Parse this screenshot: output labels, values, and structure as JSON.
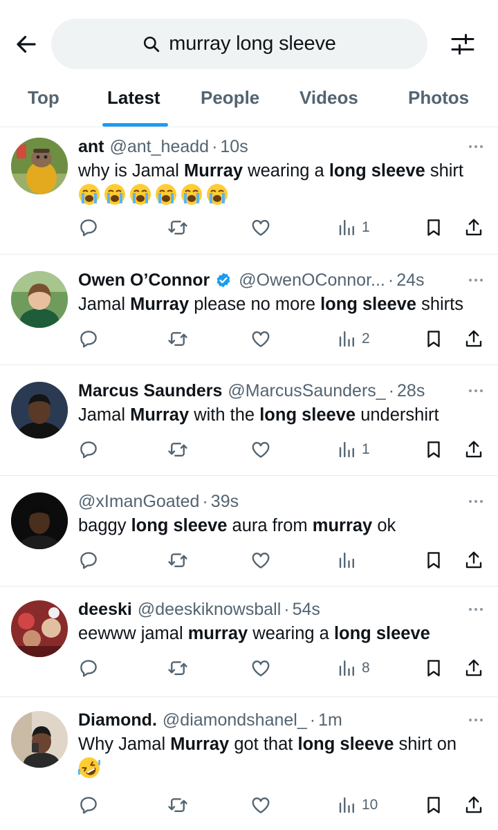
{
  "search": {
    "query": "murray long sleeve"
  },
  "tabs": [
    {
      "label": "Top"
    },
    {
      "label": "Latest"
    },
    {
      "label": "People"
    },
    {
      "label": "Videos"
    },
    {
      "label": "Photos"
    }
  ],
  "active_tab": "Latest",
  "colors": {
    "accent": "#1d9bf0",
    "secondary_text": "#536471",
    "verified": "#1d9bf0",
    "search_bg": "#eff3f4"
  },
  "posts": [
    {
      "name": "ant",
      "handle": "@ant_headd",
      "time": "10s",
      "verified": false,
      "text_plain_1": "why is Jamal ",
      "text_bold_1": "Murray",
      "text_plain_2": " wearing a ",
      "text_bold_2": "long sleeve",
      "text_plain_3": " shirt",
      "emoji": [
        "😭",
        "😭",
        "😭",
        "😭",
        "😭",
        "😭"
      ],
      "views": "1"
    },
    {
      "name": "Owen O’Connor",
      "handle": "@OwenOConnor...",
      "time": "24s",
      "verified": true,
      "text_plain_1": "Jamal ",
      "text_bold_1": "Murray",
      "text_plain_2": " please no more ",
      "text_bold_2": "long sleeve",
      "text_plain_3": " shirts",
      "views": "2"
    },
    {
      "name": "Marcus Saunders",
      "handle": "@MarcusSaunders_",
      "time": "28s",
      "verified": false,
      "text_plain_1": "Jamal ",
      "text_bold_1": "Murray",
      "text_plain_2": " with the ",
      "text_bold_2": "long sleeve",
      "text_plain_3": " undershirt",
      "views": "1"
    },
    {
      "name": "",
      "handle": "@xImanGoated",
      "time": "39s",
      "verified": false,
      "text_plain_1": "baggy ",
      "text_bold_1": "long sleeve",
      "text_plain_2": " aura from ",
      "text_bold_2": "murray",
      "text_plain_3": " ok",
      "views": ""
    },
    {
      "name": "deeski",
      "handle": "@deeskiknowsball",
      "time": "54s",
      "verified": false,
      "text_plain_1": "eewww jamal ",
      "text_bold_1": "murray",
      "text_plain_2": " wearing a ",
      "text_bold_2": "long sleeve",
      "text_plain_3": "",
      "views": "8"
    },
    {
      "name": "Diamond.",
      "handle": "@diamondshanel_",
      "time": "1m",
      "verified": false,
      "text_plain_1": "Why Jamal ",
      "text_bold_1": "Murray",
      "text_plain_2": " got that ",
      "text_bold_2": "long sleeve",
      "text_plain_3": " shirt on",
      "emoji": [
        "🤣"
      ],
      "views": "10"
    }
  ],
  "icons": {
    "back": "arrow-left-icon",
    "search": "search-icon",
    "filter": "filter-sliders-icon",
    "more": "more-dots-icon",
    "reply": "reply-icon",
    "repost": "repost-icon",
    "like": "like-icon",
    "views": "views-icon",
    "bookmark": "bookmark-icon",
    "share": "share-icon",
    "verified": "verified-badge-icon"
  }
}
